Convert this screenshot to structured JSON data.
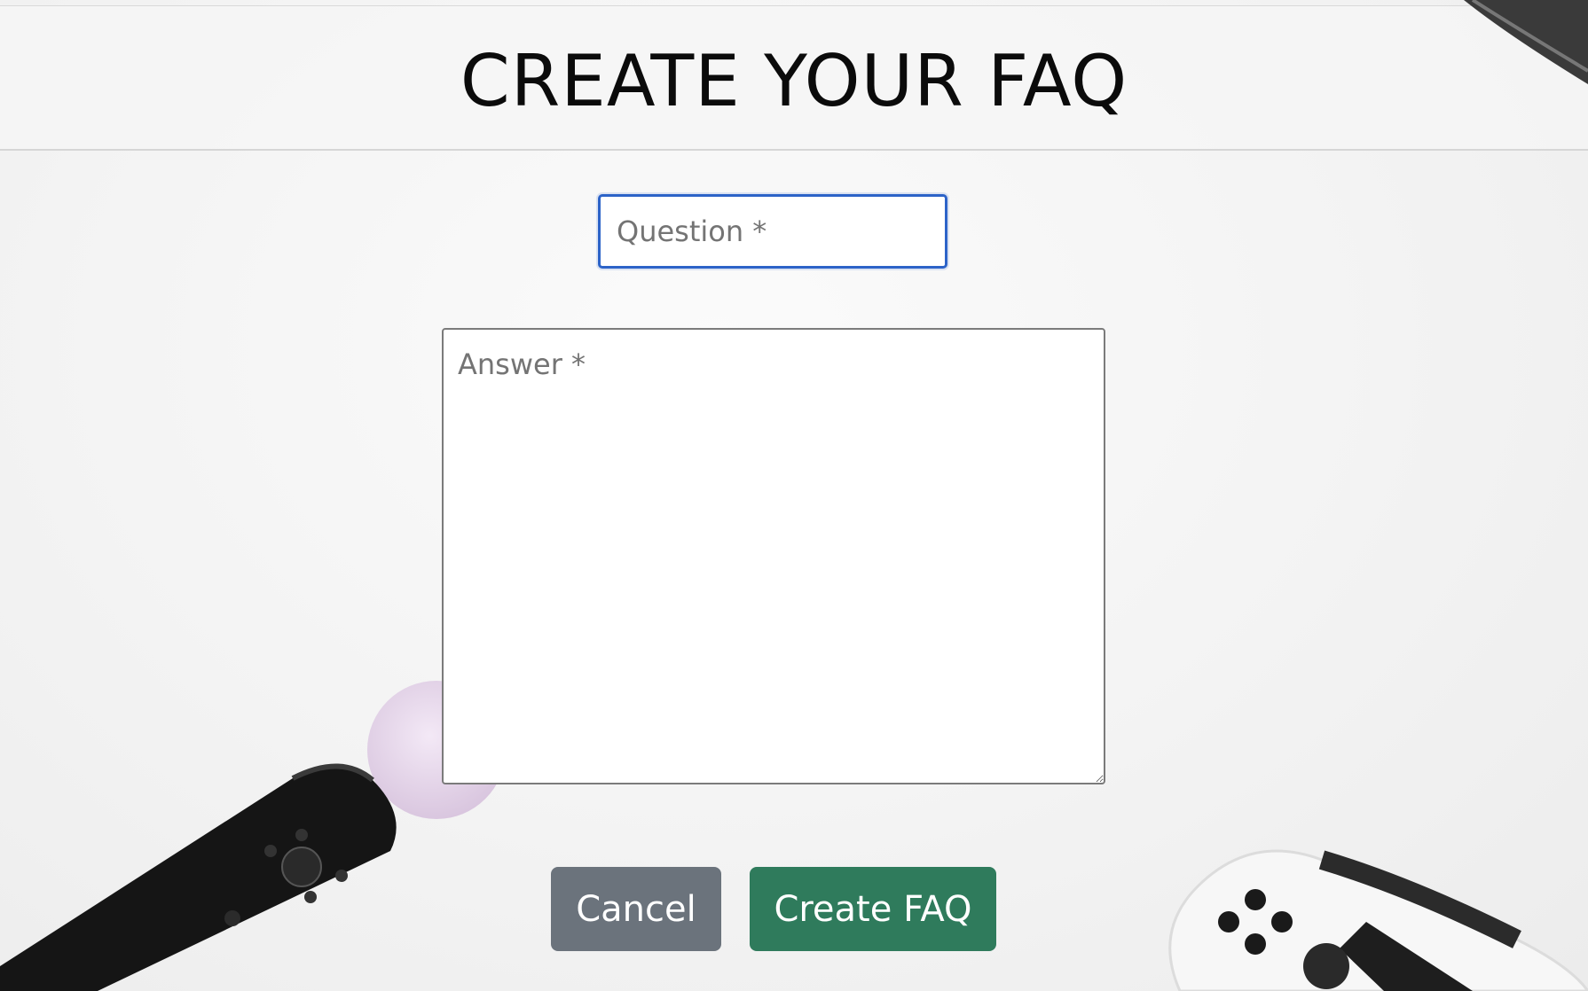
{
  "header": {
    "title": "CREATE YOUR FAQ"
  },
  "form": {
    "question_placeholder": "Question *",
    "question_value": "",
    "answer_placeholder": "Answer *",
    "answer_value": "",
    "cancel_label": "Cancel",
    "submit_label": "Create FAQ"
  },
  "colors": {
    "focus_border": "#2c63c8",
    "cancel_button": "#6b737c",
    "submit_button": "#2f7b5c",
    "background": "#f3f3f3"
  },
  "background_image": {
    "objects": [
      "motion-controller",
      "gamepad-controller",
      "headset-edge"
    ]
  }
}
